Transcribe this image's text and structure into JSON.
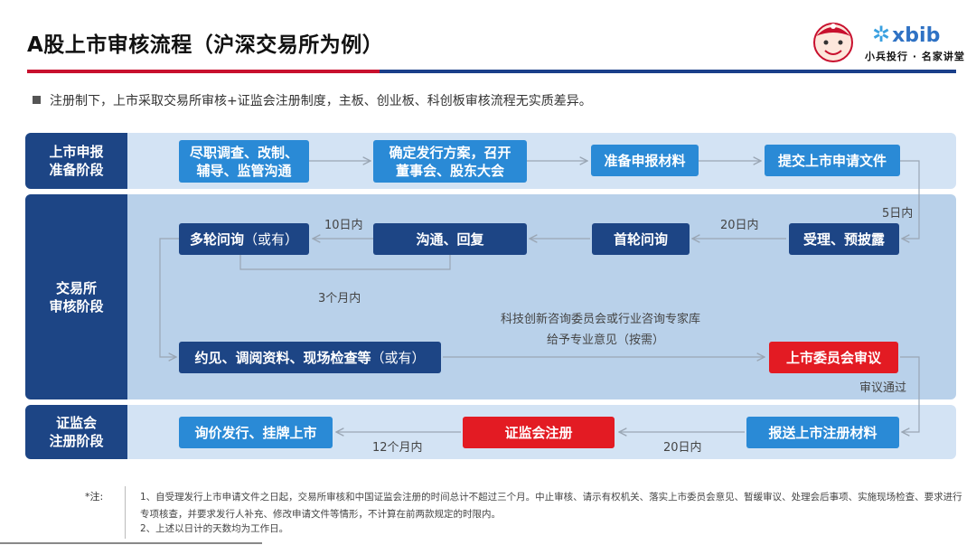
{
  "header": {
    "title": "A股上市审核流程（沪深交易所为例）",
    "brand_name": "xbib",
    "brand_tagline": "小兵投行 · 名家讲堂"
  },
  "intro": "注册制下，上市采取交易所审核+证监会注册制度，主板、创业板、科创板审核流程无实质差异。",
  "stages": {
    "prep": "上市申报\n准备阶段",
    "exchange": "交易所\n审核阶段",
    "csrc": "证监会\n注册阶段"
  },
  "boxes": {
    "due_diligence": "尽职调查、改制、\n辅导、监管沟通",
    "issue_plan": "确定发行方案，召开\n董事会、股东大会",
    "prepare_materials": "准备申报材料",
    "submit_application": "提交上市申请文件",
    "accept_disclose": "受理、预披露",
    "first_inquiry": "首轮问询",
    "communicate_reply": "沟通、回复",
    "multi_inquiry_main": "多轮问询",
    "multi_inquiry_note": "（或有）",
    "interview_main": "约见、调阅资料、现场检查等",
    "interview_note": "（或有）",
    "listing_committee": "上市委员会审议",
    "report_materials": "报送上市注册材料",
    "csrc_registration": "证监会注册",
    "pricing_listing": "询价发行、挂牌上市"
  },
  "labels": {
    "five_days": "5日内",
    "twenty_days_a": "20日内",
    "ten_days": "10日内",
    "three_months": "3个月内",
    "advisory_line1": "科技创新咨询委员会或行业咨询专家库",
    "advisory_line2": "给予专业意见（按需）",
    "review_passed": "审议通过",
    "twenty_days_b": "20日内",
    "twelve_months": "12个月内"
  },
  "notes": {
    "head": "*注:",
    "note1": "1、自受理发行上市申请文件之日起，交易所审核和中国证监会注册的时间总计不超过三个月。中止审核、请示有权机关、落实上市委员会意见、暂缓审议、处理会后事项、实施现场检查、要求进行专项核查，并要求发行人补充、修改申请文件等情形，不计算在前两款规定的时限内。",
    "note2": "2、上述以日计的天数均为工作日。"
  },
  "colors": {
    "dark_blue": "#1d4585",
    "light_blue": "#2a8ad6",
    "red": "#e31b23",
    "band_light": "#d3e3f4",
    "band_mid": "#b9d1ea"
  }
}
